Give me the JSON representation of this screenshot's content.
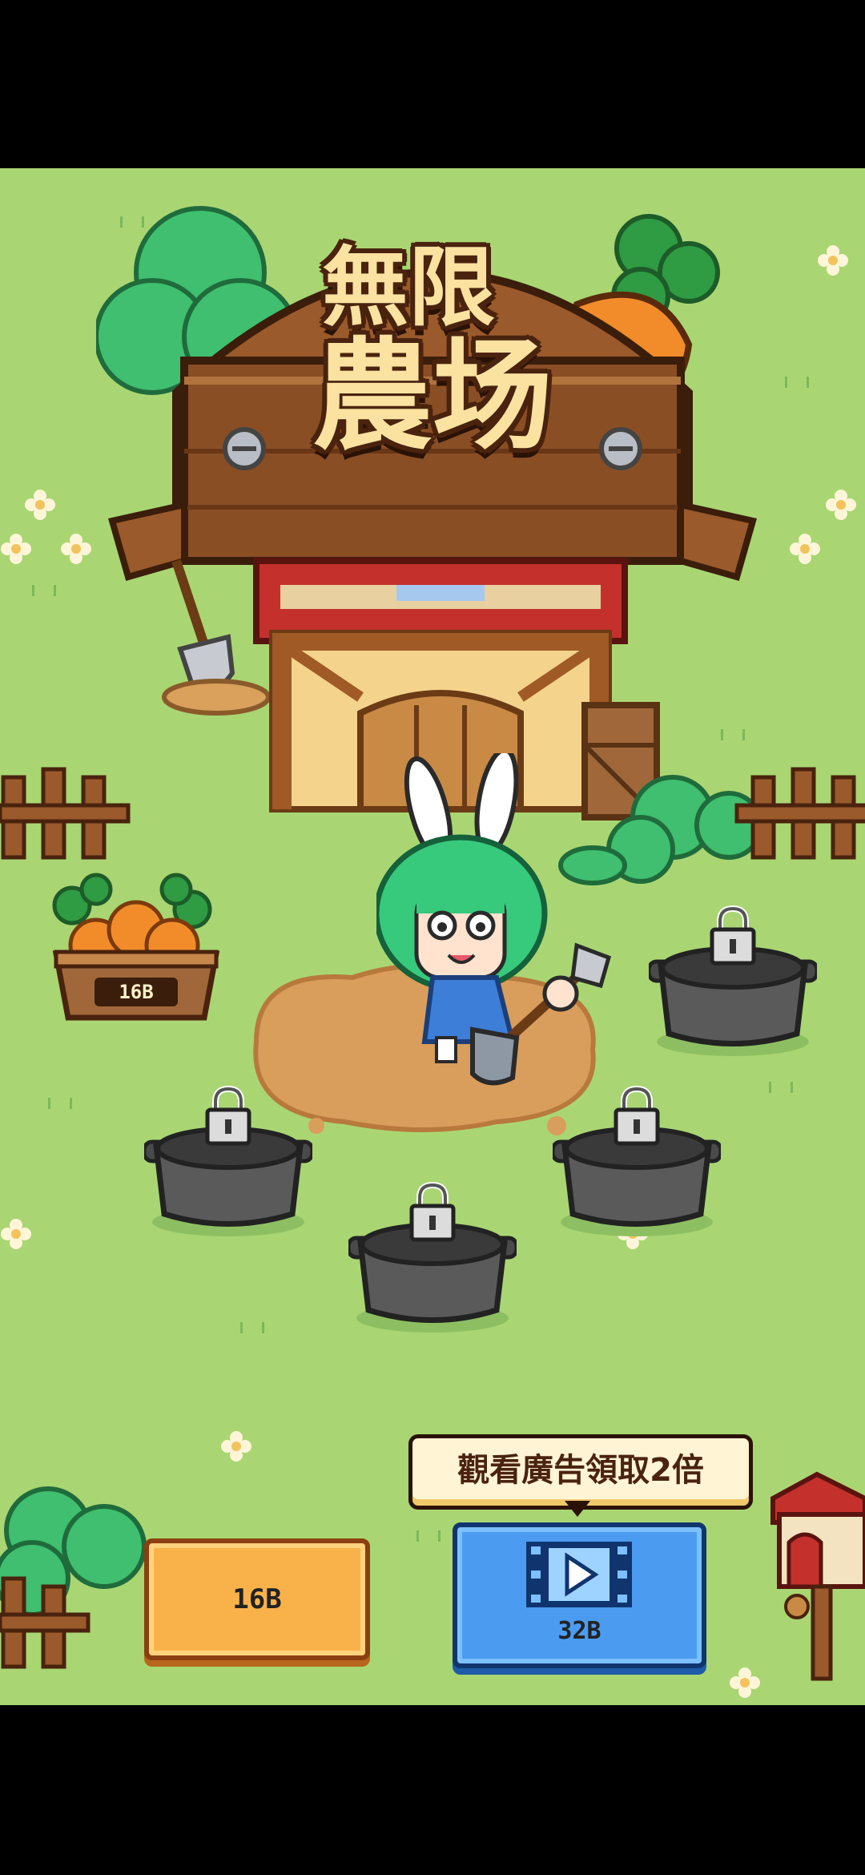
{
  "game": {
    "title_line1": "無限",
    "title_line2": "農场"
  },
  "harvest_basket": {
    "label": "16B"
  },
  "pots": [
    {
      "name": "pot-1",
      "locked": true
    },
    {
      "name": "pot-2",
      "locked": true
    },
    {
      "name": "pot-3",
      "locked": true
    },
    {
      "name": "pot-4",
      "locked": true
    }
  ],
  "buttons": {
    "collect_label": "16B",
    "ad_tooltip": "觀看廣告領取2倍",
    "ad_reward_label": "32B"
  },
  "colors": {
    "grass": "#a9d673",
    "collect_button": "#f9b24a",
    "ad_button": "#4b9cf0",
    "pot": "#5a5a5a",
    "title_text": "#fbe2a0",
    "wood": "#8a4e25"
  }
}
